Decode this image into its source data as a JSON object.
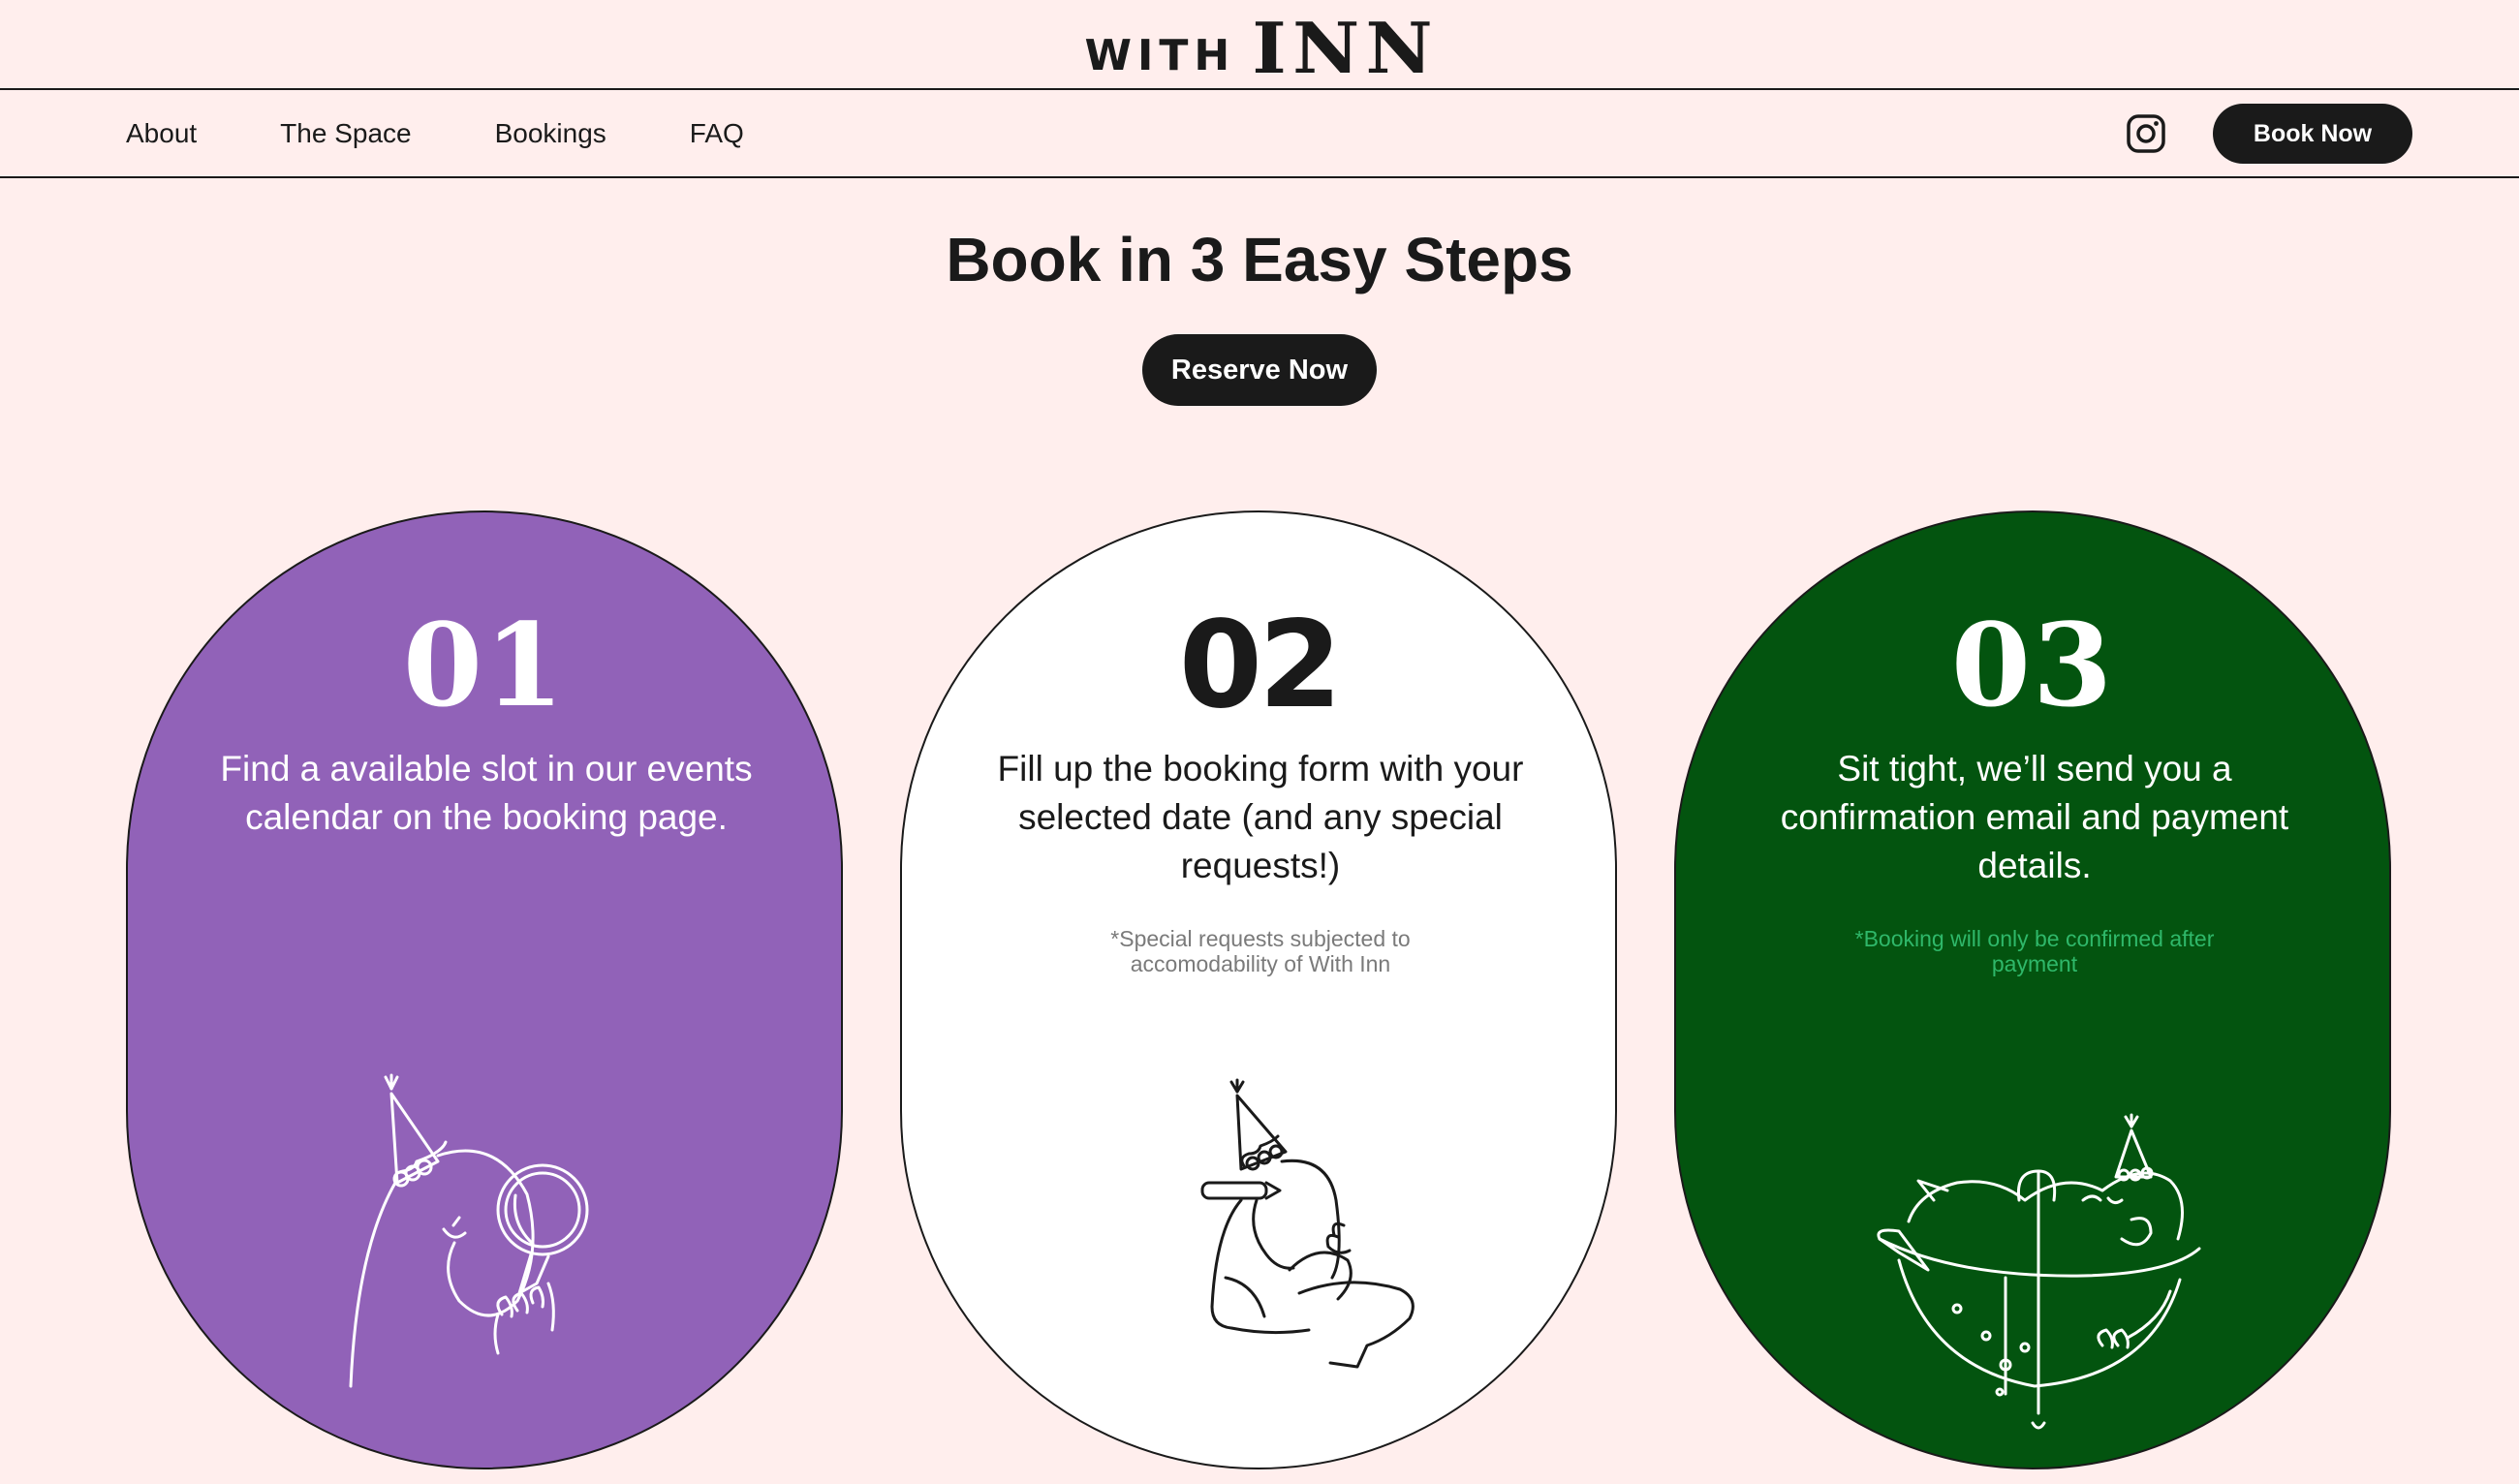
{
  "brand": {
    "logo_prefix": "WITH",
    "logo_name": "INN"
  },
  "nav": {
    "links": [
      "About",
      "The Space",
      "Bookings",
      "FAQ"
    ],
    "book_now_label": "Book Now",
    "icons": {
      "instagram": "instagram-icon"
    }
  },
  "hero": {
    "title": "Book in 3 Easy Steps",
    "reserve_label": "Reserve Now"
  },
  "steps": [
    {
      "number": "01",
      "text": "Find a available slot in our events calendar on the booking page.",
      "note": "",
      "bg_color": "#9162b8",
      "illustration": "character-with-magnifying-glass"
    },
    {
      "number": "02",
      "text": "Fill up the booking form with your selected date (and any special requests!)",
      "note": "*Special requests subjected to accomodability of With Inn",
      "bg_color": "#ffffff",
      "illustration": "character-writing-with-pencil"
    },
    {
      "number": "03",
      "text": "Sit tight, we’ll send you a confirmation email and payment details.",
      "note": "*Booking will only be confirmed after payment",
      "bg_color": "#03540f",
      "illustration": "character-relaxing-in-drink"
    }
  ],
  "colors": {
    "page_bg": "#ffeeed",
    "dark": "#1a1a1a",
    "purple": "#9162b8",
    "green": "#03540f",
    "green_note": "#2fb86a"
  }
}
